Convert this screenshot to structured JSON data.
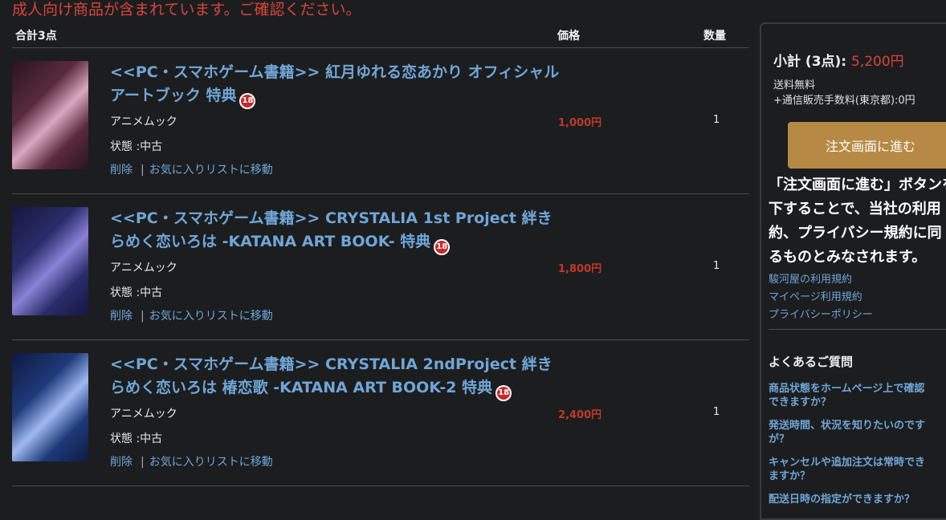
{
  "warning": "成人向け商品が含まれています。ご確認ください。",
  "cart": {
    "total_label": "合計3点",
    "price_header": "価格",
    "qty_header": "数量",
    "items": [
      {
        "title": "<<PC・スマホゲーム書籍>> 紅月ゆれる恋あかり オフィシャルアートブック 特典",
        "badge": "18",
        "category": "アニメムック",
        "condition": "状態 :中古",
        "delete": "削除",
        "move": "お気に入りリストに移動",
        "price": "1,000円",
        "qty": "1",
        "thumb_colors": [
          "#5a2a3e",
          "#d9a7c0",
          "#2a1420"
        ]
      },
      {
        "title": "<<PC・スマホゲーム書籍>> CRYSTALIA 1st Project 絆きらめく恋いろは -KATANA ART BOOK- 特典",
        "badge": "18",
        "category": "アニメムック",
        "condition": "状態 :中古",
        "delete": "削除",
        "move": "お気に入りリストに移動",
        "price": "1,800円",
        "qty": "1",
        "thumb_colors": [
          "#2a2d6a",
          "#8a82d8",
          "#151740"
        ]
      },
      {
        "title": "<<PC・スマホゲーム書籍>> CRYSTALIA 2ndProject 絆きらめく恋いろは 椿恋歌 -KATANA ART BOOK-2 特典",
        "badge": "18",
        "category": "アニメムック",
        "condition": "状態 :中古",
        "delete": "削除",
        "move": "お気に入りリストに移動",
        "price": "2,400円",
        "qty": "1",
        "thumb_colors": [
          "#1e3a7a",
          "#9fb8f0",
          "#0e1a40"
        ]
      }
    ]
  },
  "sidebar": {
    "subtotal_label": "小計 (3点):",
    "subtotal_amount": "5,200円",
    "shipping_free": "送料無料",
    "fee": "+通信販売手数料(東京都):0円",
    "order_button": "注文画面に進む",
    "notice_lines": [
      "「注文画面に進む」ボタンを",
      "下することで、当社の利用",
      "約、プライバシー規約に同",
      "るものとみなされます。"
    ],
    "links": [
      "駿河屋の利用規約",
      "マイページ利用規約",
      "プライバシーポリシー"
    ],
    "faq_title": "よくあるご質問",
    "faqs": [
      [
        "商品状態をホームページ上で確認",
        "できますか？"
      ],
      [
        "発送時間、状況を知りたいのです",
        "が？"
      ],
      [
        "キャンセルや追加注文は常時でき",
        "ますか？"
      ],
      [
        "配送日時の指定ができますか？"
      ]
    ]
  }
}
